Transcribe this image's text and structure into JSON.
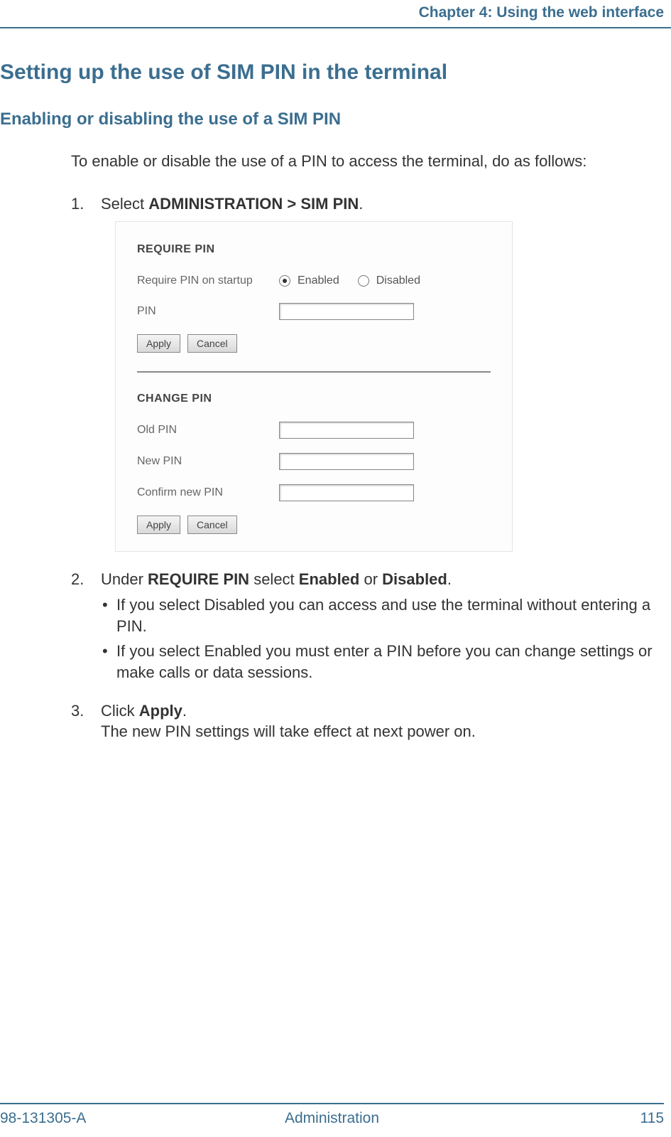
{
  "header": {
    "chapter": "Chapter 4: Using the web interface"
  },
  "title": "Setting up the use of SIM PIN in the terminal",
  "subtitle": "Enabling or disabling the use of a SIM PIN",
  "intro": "To enable or disable the use of a PIN to access the terminal, do as follows:",
  "steps": {
    "s1_pre": "Select ",
    "s1_bold": "ADMINISTRATION > SIM PIN",
    "s1_post": ".",
    "s2_p1": "Under ",
    "s2_b1": "REQUIRE PIN",
    "s2_p2": " select ",
    "s2_b2": "Enabled",
    "s2_p3": " or ",
    "s2_b3": "Disabled",
    "s2_p4": ".",
    "s2_bullet1": "If you select Disabled you can access and use the terminal without entering a PIN.",
    "s2_bullet2": "If you select Enabled you must enter a PIN before you can change settings or make calls or data sessions.",
    "s3_p1": "Click ",
    "s3_b1": "Apply",
    "s3_p2": ".",
    "s3_line2": "The new PIN settings will take effect at next power on."
  },
  "screenshot": {
    "require_pin_title": "REQUIRE PIN",
    "require_label": "Require PIN on startup",
    "enabled": "Enabled",
    "disabled": "Disabled",
    "pin_label": "PIN",
    "apply": "Apply",
    "cancel": "Cancel",
    "change_pin_title": "CHANGE PIN",
    "old_pin": "Old PIN",
    "new_pin": "New PIN",
    "confirm_pin": "Confirm new PIN"
  },
  "footer": {
    "doc_number": "98-131305-A",
    "section": "Administration",
    "page": "115"
  }
}
